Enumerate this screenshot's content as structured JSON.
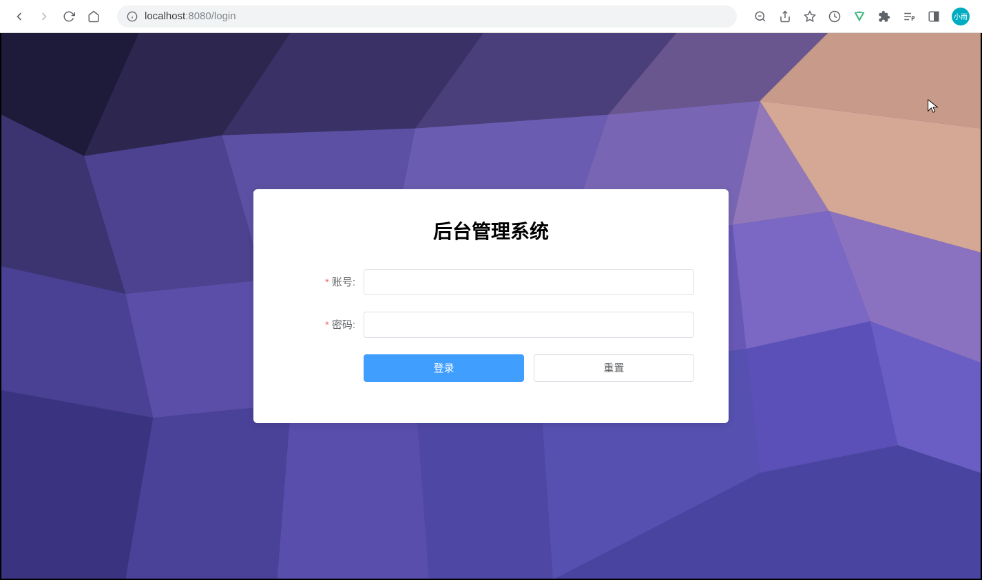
{
  "browser": {
    "url_host": "localhost",
    "url_port": ":8080",
    "url_path": "/login",
    "avatar_label": "小雨"
  },
  "login": {
    "title": "后台管理系统",
    "username_label": "账号:",
    "username_value": "",
    "password_label": "密码:",
    "password_value": "",
    "submit_label": "登录",
    "reset_label": "重置"
  }
}
